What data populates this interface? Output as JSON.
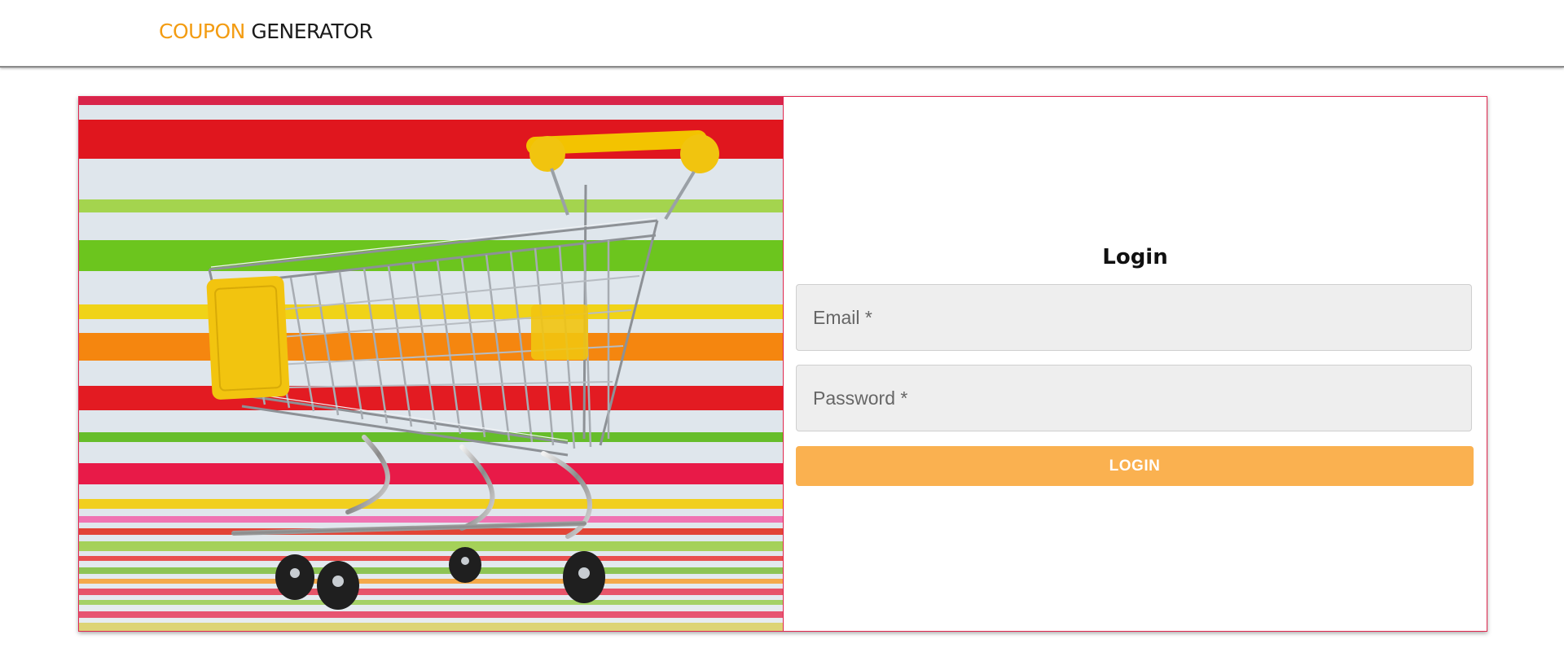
{
  "header": {
    "brand_accent": "COUPON",
    "brand_rest": "GENERATOR",
    "accent_color": "#f39c12"
  },
  "hero_image": {
    "subject": "shopping-cart",
    "alt": "Shopping cart in front of colorful stripes"
  },
  "login": {
    "title": "Login",
    "email_placeholder": "Email *",
    "email_value": "",
    "password_placeholder": "Password *",
    "password_value": "",
    "button_label": "LOGIN",
    "button_color": "#fab150",
    "card_border_color": "#e0264e"
  }
}
